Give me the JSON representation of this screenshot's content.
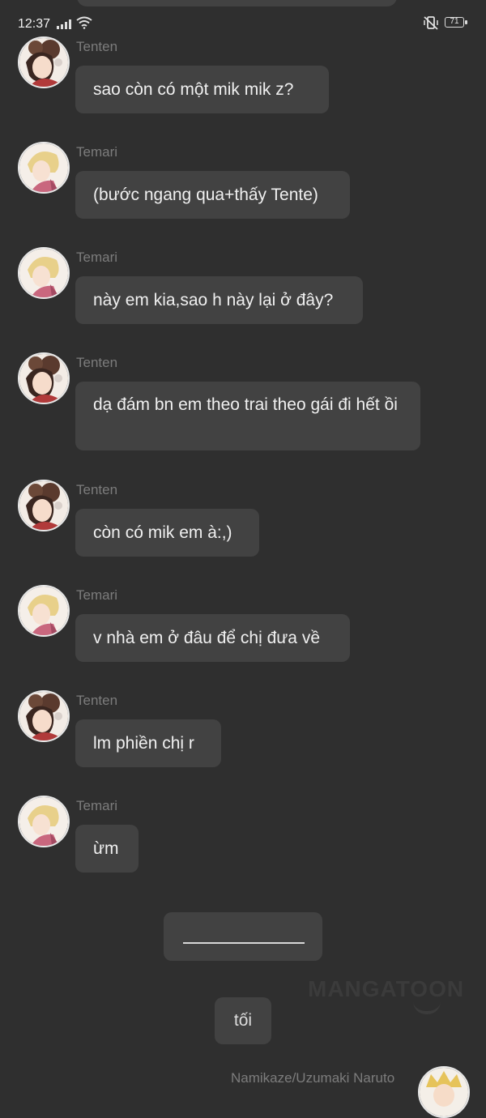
{
  "status_bar": {
    "time": "12:37",
    "battery": "71"
  },
  "messages": [
    {
      "sender": "Tenten",
      "text": "sao còn có một mik mik z?",
      "avatar": "tenten-avatar"
    },
    {
      "sender": "Temari",
      "text": "(bước ngang qua+thấy Tente)",
      "avatar": "temari-avatar"
    },
    {
      "sender": "Temari",
      "text": "này em kia,sao h này lại ở đây?",
      "avatar": "temari-avatar"
    },
    {
      "sender": "Tenten",
      "text": "dạ đám bn em theo trai theo gái đi hết ồi",
      "avatar": "tenten-avatar"
    },
    {
      "sender": "Tenten",
      "text": "còn có mik em à:,)",
      "avatar": "tenten-avatar"
    },
    {
      "sender": "Temari",
      "text": "v nhà em ở đâu để chị đưa về",
      "avatar": "temari-avatar"
    },
    {
      "sender": "Tenten",
      "text": "lm phiền chị r",
      "avatar": "tenten-avatar"
    },
    {
      "sender": "Temari",
      "text": "ừm",
      "avatar": "temari-avatar"
    }
  ],
  "narration": {
    "text": "tối"
  },
  "watermark": "MANGATOON",
  "next_message": {
    "sender": "Namikaze/Uzumaki Naruto"
  },
  "colors": {
    "background": "#2f2f2f",
    "bubble": "#424242",
    "sender_name": "#7c7c7c",
    "text": "#f0f0f0"
  }
}
